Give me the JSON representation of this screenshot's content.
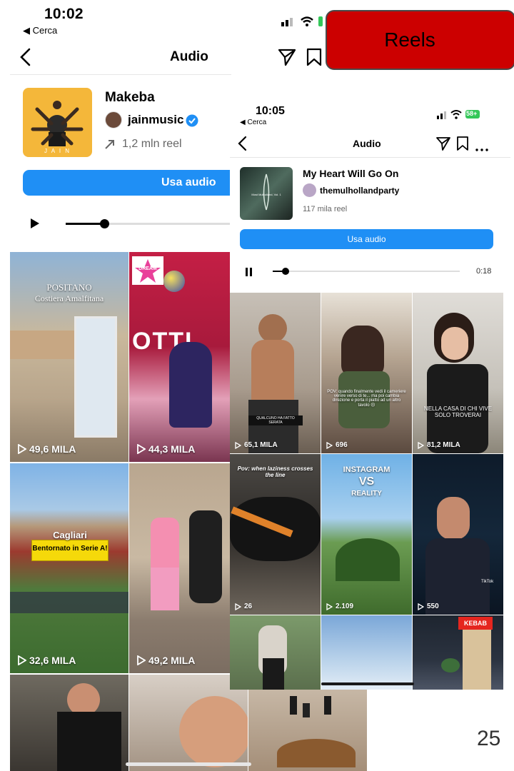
{
  "back": {
    "status": {
      "time": "10:02",
      "back_label": "◀ Cerca"
    },
    "nav": {
      "title": "Audio"
    },
    "track": {
      "title": "Makeba",
      "artist": "jainmusic",
      "reels": "1,2 mln reel",
      "cover_text": "J A I N"
    },
    "use_audio": "Usa audio",
    "grid": [
      {
        "views": "49,6 MILA",
        "caption": "POSITANO",
        "caption2": "Costiera Amalfitana"
      },
      {
        "views": "44,3 MILA",
        "caption": "OTTI",
        "caption2": "DREAM"
      },
      {
        "views": "32,6 MILA",
        "caption": "Cagliari",
        "caption2": "Bentornato in Serie A!"
      },
      {
        "views": "49,2 MILA"
      }
    ]
  },
  "inset": {
    "status": {
      "time": "10:05",
      "back_label": "◀ Cerca",
      "battery": "58+"
    },
    "nav": {
      "title": "Audio"
    },
    "track": {
      "title": "My Heart Will Go On",
      "artist": "themulhollandparty",
      "reels": "117 mila reel",
      "cover_text": "Most Mulholland, Vol. 1"
    },
    "use_audio": "Usa audio",
    "duration": "0:18",
    "grid": [
      {
        "views": "65,1 MILA",
        "caption": "QUALCUNO HA FATTO SERATA"
      },
      {
        "views": "696",
        "caption": "POV: quando finalmente vedi il cameriere venire verso di te... ma poi cambia direzione e porta il piatto ad un altro tavolo 😔"
      },
      {
        "views": "81,2 MILA",
        "caption": "NELLA CASA DI CHI VIVE SOLO TROVERAI"
      },
      {
        "views": "26",
        "caption": "Pov: when laziness crosses the line"
      },
      {
        "views": "2.109",
        "caption": "INSTAGRAM",
        "caption2": "VS",
        "caption3": "REALITY"
      },
      {
        "views": "550",
        "caption": "TikTok"
      },
      {},
      {},
      {
        "caption": "KEBAB"
      }
    ]
  },
  "overlay": {
    "reels_label": "Reels",
    "page_number": "25"
  }
}
